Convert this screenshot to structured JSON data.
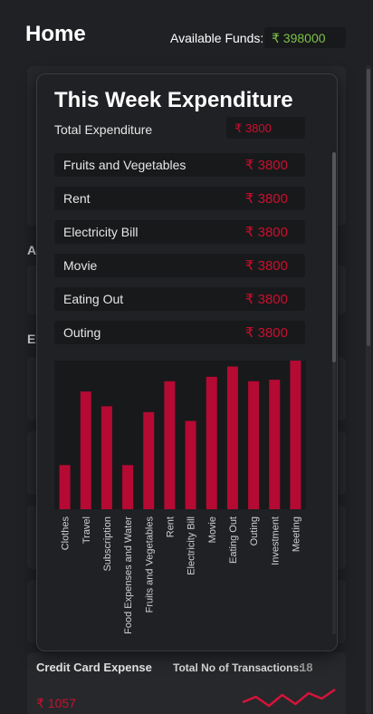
{
  "header": {
    "title": "Home",
    "funds_label": "Available Funds:",
    "funds_value": "₹ 398000"
  },
  "background": {
    "label_a": "A",
    "label_ex": "Ex"
  },
  "credit_card": {
    "title": "Credit Card Expense",
    "tx_label": "Total No of Transactions:",
    "tx_value": "18",
    "amount": "₹ 1057"
  },
  "modal": {
    "title": "This Week Expenditure",
    "total_label": "Total Expenditure",
    "total_value": "₹ 3800",
    "items": [
      {
        "name": "Fruits and Vegetables",
        "value": "₹ 3800"
      },
      {
        "name": "Rent",
        "value": "₹ 3800"
      },
      {
        "name": "Electricity Bill",
        "value": "₹ 3800"
      },
      {
        "name": "Movie",
        "value": "₹ 3800"
      },
      {
        "name": "Eating Out",
        "value": "₹ 3800"
      },
      {
        "name": "Outing",
        "value": "₹ 3800"
      }
    ]
  },
  "colors": {
    "accent_red": "#c8102e",
    "bar_red": "#b50a33",
    "funds_green": "#7dc24b",
    "spark_red": "#d4143a"
  },
  "chart_data": {
    "type": "bar",
    "categories": [
      "Clothes",
      "Travel",
      "Subscription",
      "Food Expenses and Water",
      "Fruits and Vegetables",
      "Rent",
      "Electricity Bill",
      "Movie",
      "Eating Out",
      "Outing",
      "Investment",
      "Meeting"
    ],
    "values": [
      30,
      80,
      70,
      30,
      66,
      87,
      60,
      90,
      97,
      87,
      88,
      101
    ],
    "ylim": [
      0,
      101
    ],
    "grid": false,
    "title": "",
    "xlabel": "",
    "ylabel": ""
  },
  "sparkline": {
    "values": [
      5,
      8,
      3,
      9,
      4,
      10,
      7,
      12
    ]
  }
}
